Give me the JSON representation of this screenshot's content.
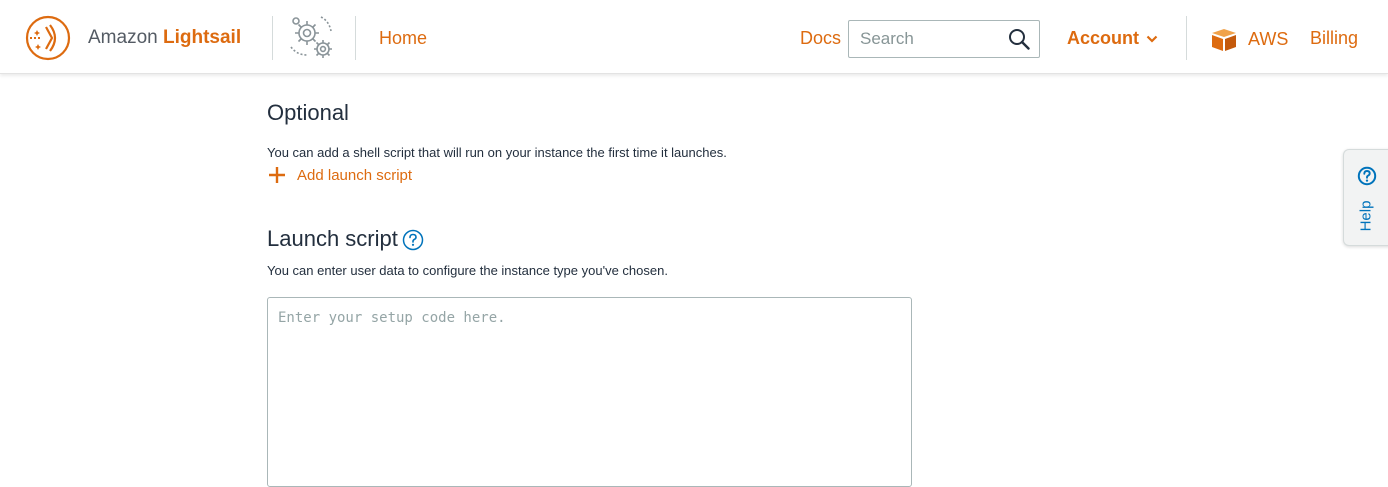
{
  "header": {
    "brand_prefix": "Amazon",
    "brand_name": "Lightsail",
    "home_label": "Home",
    "docs_label": "Docs",
    "search_placeholder": "Search",
    "account_label": "Account",
    "aws_label": "AWS",
    "billing_label": "Billing"
  },
  "optional": {
    "title": "Optional",
    "description": "You can add a shell script that will run on your instance the first time it launches.",
    "add_label": "Add launch script"
  },
  "launch_script": {
    "title": "Launch script",
    "description": "You can enter user data to configure the instance type you've chosen.",
    "placeholder": "Enter your setup code here."
  },
  "help_tab": {
    "label": "Help"
  },
  "colors": {
    "accent": "#dd6b10",
    "link_blue": "#0073bb",
    "text": "#232f3e"
  },
  "icons": [
    "lightsail-logo-icon",
    "gears-icon",
    "search-icon",
    "chevron-down-icon",
    "aws-cube-icon",
    "plus-icon",
    "info-icon",
    "help-icon"
  ]
}
